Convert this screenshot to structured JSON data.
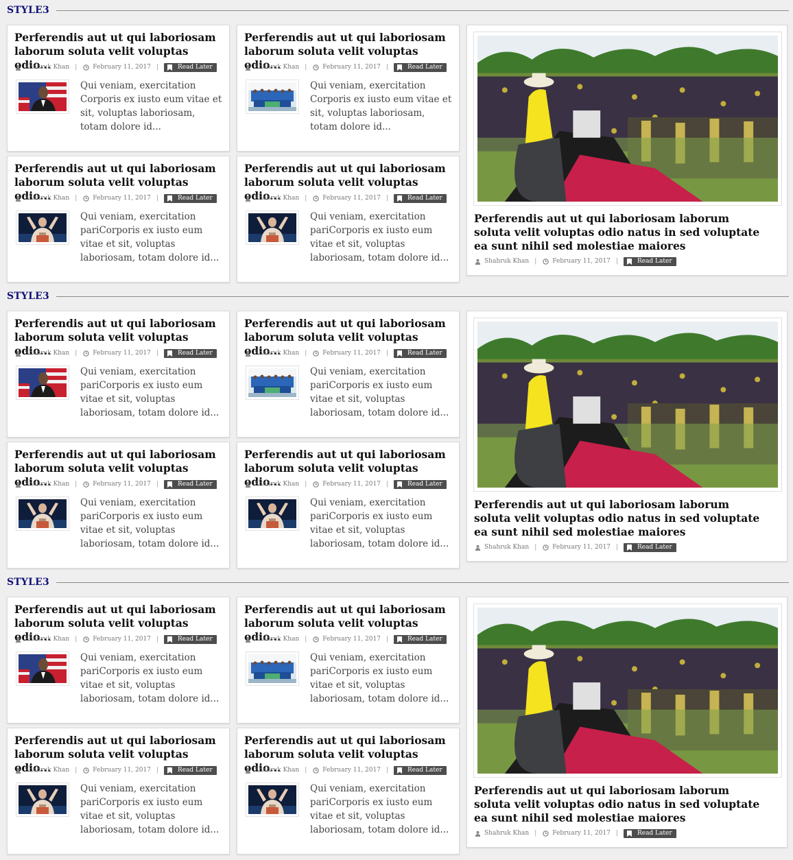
{
  "sections": [
    {
      "title": "STYLE3",
      "small_cards": [
        {
          "title": "Perferendis aut ut qui laboriosam laborum soluta velit voluptas odio...",
          "author": "Shahruk Khan",
          "date": "February 11, 2017",
          "read_later": "Read Later",
          "thumb": "obama-photo",
          "excerpt": "Qui veniam, exercitation Corporis ex iusto eum vitae et sit, voluptas laboriosam, totam dolore id..."
        },
        {
          "title": "Perferendis aut ut qui laboriosam laborum soluta velit voluptas odio...",
          "author": "Shahruk Khan",
          "date": "February 11, 2017",
          "read_later": "Read Later",
          "thumb": "team-photo",
          "excerpt": "Qui veniam, exercitation Corporis ex iusto eum vitae et sit, voluptas laboriosam, totam dolore id..."
        },
        {
          "title": "Perferendis aut ut qui laboriosam laborum soluta velit voluptas odio...",
          "author": "Shahruk Khan",
          "date": "February 11, 2017",
          "read_later": "Read Later",
          "thumb": "speaker-photo",
          "excerpt": "Qui veniam, exercitation pariCorporis ex iusto eum vitae et sit, voluptas laboriosam, totam dolore id..."
        },
        {
          "title": "Perferendis aut ut qui laboriosam laborum soluta velit voluptas odio...",
          "author": "Shahruk Khan",
          "date": "February 11, 2017",
          "read_later": "Read Later",
          "thumb": "speaker-photo",
          "excerpt": "Qui veniam, exercitation pariCorporis ex iusto eum vitae et sit, voluptas laboriosam, totam dolore id..."
        }
      ],
      "big_card": {
        "title": "Perferendis aut ut qui laboriosam laborum soluta velit voluptas odio natus in sed voluptate ea sunt nihil sed molestiae maiores",
        "author": "Shahruk Khan",
        "date": "February 11, 2017",
        "read_later": "Read Later",
        "image": "rally-photo"
      }
    },
    {
      "title": "STYLE3",
      "small_cards": [
        {
          "title": "Perferendis aut ut qui laboriosam laborum soluta velit voluptas odio...",
          "author": "Shahruk Khan",
          "date": "February 11, 2017",
          "read_later": "Read Later",
          "thumb": "obama-photo",
          "excerpt": "Qui veniam, exercitation pariCorporis ex iusto eum vitae et sit, voluptas laboriosam, totam dolore id..."
        },
        {
          "title": "Perferendis aut ut qui laboriosam laborum soluta velit voluptas odio...",
          "author": "Shahruk Khan",
          "date": "February 11, 2017",
          "read_later": "Read Later",
          "thumb": "team-photo",
          "excerpt": "Qui veniam, exercitation pariCorporis ex iusto eum vitae et sit, voluptas laboriosam, totam dolore id..."
        },
        {
          "title": "Perferendis aut ut qui laboriosam laborum soluta velit voluptas odio...",
          "author": "Shahruk Khan",
          "date": "February 11, 2017",
          "read_later": "Read Later",
          "thumb": "speaker-photo",
          "excerpt": "Qui veniam, exercitation pariCorporis ex iusto eum vitae et sit, voluptas laboriosam, totam dolore id..."
        },
        {
          "title": "Perferendis aut ut qui laboriosam laborum soluta velit voluptas odio...",
          "author": "Shahruk Khan",
          "date": "February 11, 2017",
          "read_later": "Read Later",
          "thumb": "speaker-photo",
          "excerpt": "Qui veniam, exercitation pariCorporis ex iusto eum vitae et sit, voluptas laboriosam, totam dolore id..."
        }
      ],
      "big_card": {
        "title": "Perferendis aut ut qui laboriosam laborum soluta velit voluptas odio natus in sed voluptate ea sunt nihil sed molestiae maiores",
        "author": "Shahruk Khan",
        "date": "February 11, 2017",
        "read_later": "Read Later",
        "image": "rally-photo"
      }
    },
    {
      "title": "STYLE3",
      "small_cards": [
        {
          "title": "Perferendis aut ut qui laboriosam laborum soluta velit voluptas odio...",
          "author": "Shahruk Khan",
          "date": "February 11, 2017",
          "read_later": "Read Later",
          "thumb": "obama-photo",
          "excerpt": "Qui veniam, exercitation pariCorporis ex iusto eum vitae et sit, voluptas laboriosam, totam dolore id..."
        },
        {
          "title": "Perferendis aut ut qui laboriosam laborum soluta velit voluptas odio...",
          "author": "Shahruk Khan",
          "date": "February 11, 2017",
          "read_later": "Read Later",
          "thumb": "team-photo",
          "excerpt": "Qui veniam, exercitation pariCorporis ex iusto eum vitae et sit, voluptas laboriosam, totam dolore id..."
        },
        {
          "title": "Perferendis aut ut qui laboriosam laborum soluta velit voluptas odio...",
          "author": "Shahruk Khan",
          "date": "February 11, 2017",
          "read_later": "Read Later",
          "thumb": "speaker-photo",
          "excerpt": "Qui veniam, exercitation pariCorporis ex iusto eum vitae et sit, voluptas laboriosam, totam dolore id..."
        },
        {
          "title": "Perferendis aut ut qui laboriosam laborum soluta velit voluptas odio...",
          "author": "Shahruk Khan",
          "date": "February 11, 2017",
          "read_later": "Read Later",
          "thumb": "speaker-photo",
          "excerpt": "Qui veniam, exercitation pariCorporis ex iusto eum vitae et sit, voluptas laboriosam, totam dolore id..."
        }
      ],
      "big_card": {
        "title": "Perferendis aut ut qui laboriosam laborum soluta velit voluptas odio natus in sed voluptate ea sunt nihil sed molestiae maiores",
        "author": "Shahruk Khan",
        "date": "February 11, 2017",
        "read_later": "Read Later",
        "image": "rally-photo"
      }
    }
  ],
  "colors": {
    "section_title": "#12127a",
    "read_later_bg": "#4d4d4d",
    "page_bg": "#efefef"
  }
}
